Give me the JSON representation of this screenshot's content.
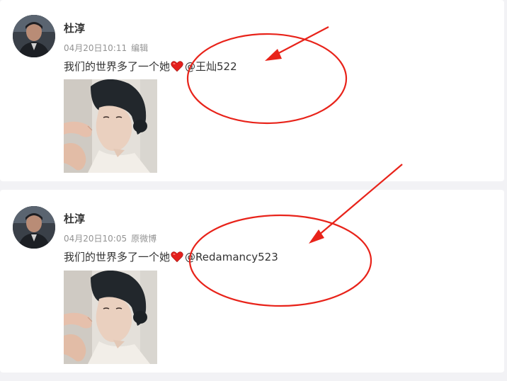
{
  "posts": [
    {
      "author": "杜淳",
      "time": "04月20日10:11",
      "source": "编辑",
      "text": "我们的世界多了一个她",
      "mention": "@王灿522"
    },
    {
      "author": "杜淳",
      "time": "04月20日10:05",
      "source": "原微博",
      "text": "我们的世界多了一个她",
      "mention": "@Redamancy523"
    }
  ],
  "colors": {
    "annotation": "#e8231a",
    "heart": "#e3201d",
    "meta_text": "#939393"
  },
  "icons": [
    "heart-emoji-icon"
  ]
}
